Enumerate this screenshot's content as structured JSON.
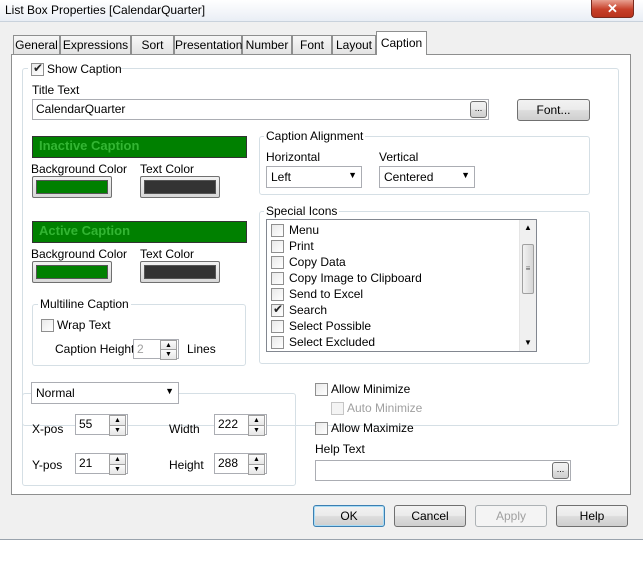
{
  "window": {
    "title": "List Box Properties [CalendarQuarter]",
    "close_label": "✕"
  },
  "tabs": [
    "General",
    "Expressions",
    "Sort",
    "Presentation",
    "Number",
    "Font",
    "Layout",
    "Caption"
  ],
  "active_tab": "Caption",
  "show_caption": {
    "label": "Show Caption",
    "checked": true
  },
  "title_text": {
    "label": "Title Text",
    "value": "CalendarQuarter",
    "ellipsis": "...",
    "font_button": "Font..."
  },
  "inactive_caption": {
    "label": "Inactive Caption",
    "bg_label": "Background Color",
    "text_label": "Text Color",
    "bg_color": "#008000",
    "text_color": "#333333"
  },
  "active_caption": {
    "label": "Active Caption",
    "bg_label": "Background Color",
    "text_label": "Text Color",
    "bg_color": "#008000",
    "text_color": "#333333"
  },
  "caption_alignment": {
    "label": "Caption Alignment",
    "horizontal_label": "Horizontal",
    "horizontal_value": "Left",
    "vertical_label": "Vertical",
    "vertical_value": "Centered"
  },
  "special_icons": {
    "label": "Special Icons",
    "items": [
      {
        "label": "Menu",
        "checked": false
      },
      {
        "label": "Print",
        "checked": false
      },
      {
        "label": "Copy Data",
        "checked": false
      },
      {
        "label": "Copy Image to Clipboard",
        "checked": false
      },
      {
        "label": "Send to Excel",
        "checked": false
      },
      {
        "label": "Search",
        "checked": true
      },
      {
        "label": "Select Possible",
        "checked": false
      },
      {
        "label": "Select Excluded",
        "checked": false
      }
    ]
  },
  "multiline": {
    "label": "Multiline Caption",
    "wrap_label": "Wrap Text",
    "height_label": "Caption Height",
    "height_value": "2",
    "lines_label": "Lines"
  },
  "size_mode": {
    "value": "Normal"
  },
  "position": {
    "xpos_label": "X-pos",
    "xpos": "55",
    "ypos_label": "Y-pos",
    "ypos": "21",
    "width_label": "Width",
    "width": "222",
    "height_label": "Height",
    "height": "288"
  },
  "allow_minimize": "Allow Minimize",
  "auto_minimize": "Auto Minimize",
  "allow_maximize": "Allow Maximize",
  "help_text": {
    "label": "Help Text",
    "value": "",
    "ellipsis": "..."
  },
  "buttons": {
    "ok": "OK",
    "cancel": "Cancel",
    "apply": "Apply",
    "help": "Help"
  },
  "colors": {
    "caption_green": "#008000",
    "caption_text": "#33b533"
  }
}
